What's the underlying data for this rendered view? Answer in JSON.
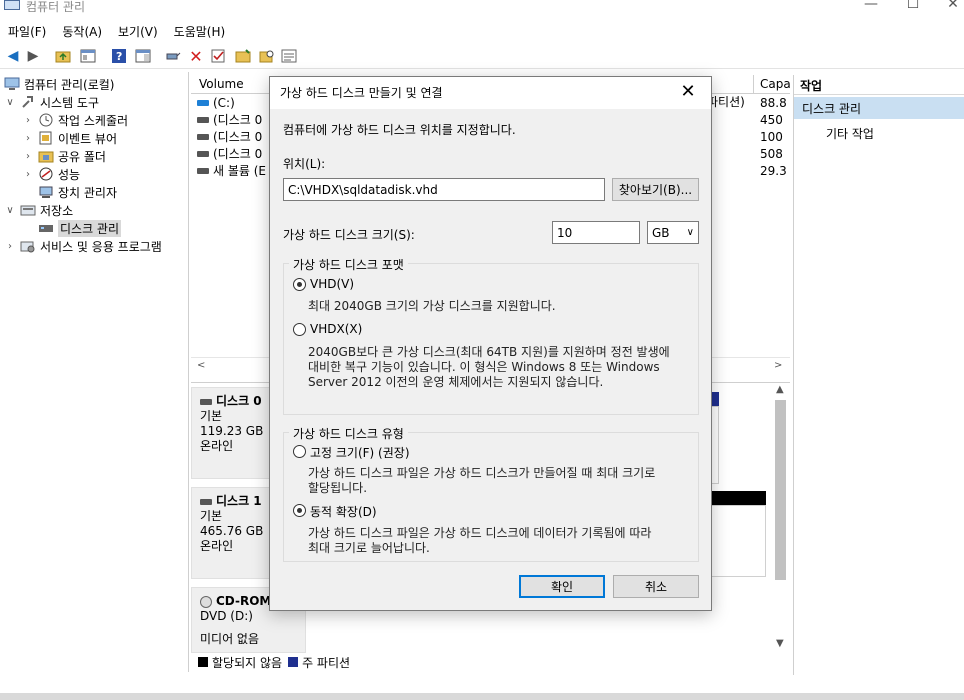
{
  "window": {
    "title": "컴퓨터 관리",
    "minimize": "—",
    "maximize": "☐",
    "close": "✕"
  },
  "menu": [
    "파일(F)",
    "동작(A)",
    "보기(V)",
    "도움말(H)"
  ],
  "toolbar": {
    "icons": [
      "back-icon",
      "forward-icon",
      "up-folder-icon",
      "properties-icon",
      "help-icon",
      "show-hide-icon",
      "connect-icon",
      "delete-icon",
      "check-icon",
      "folder-icon",
      "search-icon",
      "list-icon"
    ]
  },
  "tree": {
    "root": "컴퓨터 관리(로컬)",
    "system_tools": "시스템 도구",
    "task_scheduler": "작업 스케줄러",
    "event_viewer": "이벤트 뷰어",
    "shared_folders": "공유 폴더",
    "performance": "성능",
    "device_manager": "장치 관리자",
    "storage": "저장소",
    "disk_management": "디스크 관리",
    "services_apps": "서비스 및 응용 프로그램"
  },
  "volumes": {
    "col_volume": "Volume",
    "col_capacity": "Capa",
    "partial_partition": "파티션)",
    "rows": [
      {
        "name": "(C:)",
        "cap": "88.8"
      },
      {
        "name": "(디스크 0",
        "cap": "450"
      },
      {
        "name": "(디스크 0",
        "cap": "100"
      },
      {
        "name": "(디스크 0",
        "cap": "508"
      },
      {
        "name": "새 볼륨 (E",
        "cap": "29.3"
      }
    ]
  },
  "disks": [
    {
      "title": "디스크 0",
      "type": "기본",
      "size": "119.23 GB",
      "status": "온라인"
    },
    {
      "title": "디스크 1",
      "type": "기본",
      "size": "465.76 GB",
      "status": "온라인"
    },
    {
      "title": "CD-ROM",
      "type": "DVD (D:)",
      "size": "",
      "status": "미디어 없음"
    }
  ],
  "legend": {
    "unallocated": "할당되지 않음",
    "primary": "주 파티션"
  },
  "actions": {
    "header": "작업",
    "disk_management": "디스크 관리",
    "more": "기타 작업"
  },
  "dialog": {
    "title": "가상 하드 디스크 만들기 및 연결",
    "close": "✕",
    "intro": "컴퓨터에 가상 하드 디스크 위치를 지정합니다.",
    "location_label": "위치(L):",
    "location_value": "C:\\VHDX\\sqldatadisk.vhd",
    "browse": "찾아보기(B)...",
    "size_label": "가상 하드 디스크 크기(S):",
    "size_value": "10",
    "size_unit": "GB",
    "format_group": "가상 하드 디스크 포맷",
    "vhd_label": "VHD(V)",
    "vhd_desc": "최대 2040GB 크기의 가상 디스크를 지원합니다.",
    "vhdx_label": "VHDX(X)",
    "vhdx_desc_1": "2040GB보다 큰 가상 디스크(최대 64TB 지원)를 지원하며 정전 발생에",
    "vhdx_desc_2": "대비한 복구 기능이 있습니다. 이 형식은 Windows 8 또는 Windows",
    "vhdx_desc_3": "Server 2012 이전의 운영 체제에서는 지원되지 않습니다.",
    "type_group": "가상 하드 디스크 유형",
    "fixed_label": "고정 크기(F) (권장)",
    "fixed_desc_1": "가상 하드 디스크 파일은 가상 하드 디스크가 만들어질 때 최대 크기로",
    "fixed_desc_2": "할당됩니다.",
    "dynamic_label": "동적 확장(D)",
    "dynamic_desc_1": "가상 하드 디스크 파일은 가상 하드 디스크에 데이터가 기록됨에 따라",
    "dynamic_desc_2": "최대 크기로 늘어납니다.",
    "ok": "확인",
    "cancel": "취소",
    "format_selected": "VHD",
    "type_selected": "dynamic"
  },
  "colors": {
    "accent": "#0078d7",
    "selection": "#c9dff2",
    "primary_partition": "#1f2f8f",
    "unallocated": "#000000"
  }
}
